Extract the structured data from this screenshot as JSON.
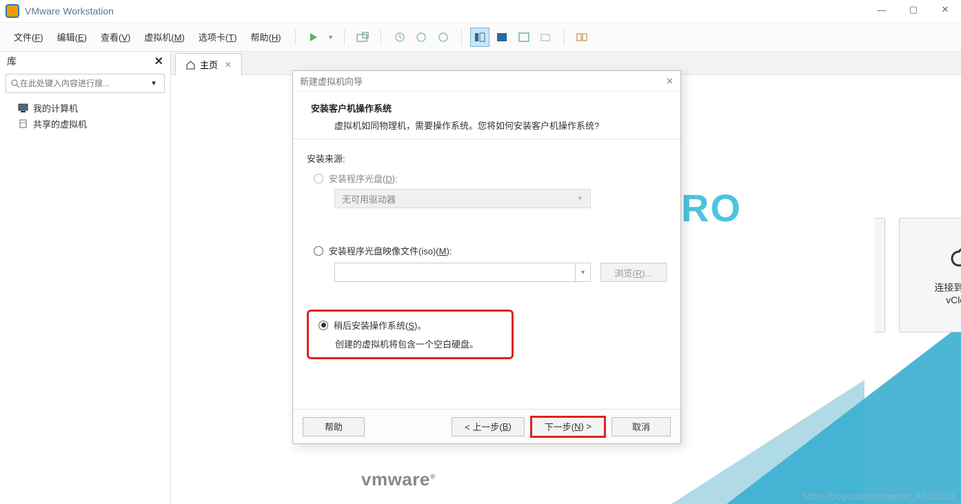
{
  "titlebar": {
    "app_name": "VMware Workstation"
  },
  "window_controls": {
    "min": "—",
    "max": "▢",
    "close": "✕"
  },
  "menu": {
    "file": "文件(F)",
    "edit": "编辑(E)",
    "view": "查看(V)",
    "vm": "虚拟机(M)",
    "tabs": "选项卡(T)",
    "help": "帮助(H)"
  },
  "sidebar": {
    "title": "库",
    "search_placeholder": "在此处键入内容进行搜...",
    "items": [
      {
        "label": "我的计算机"
      },
      {
        "label": "共享的虚拟机"
      }
    ]
  },
  "tab": {
    "home_label": "主页"
  },
  "bg": {
    "pro_text": "RO"
  },
  "cloud_card": {
    "line1": "连接到 VMware",
    "line2": "vCloud Air"
  },
  "vmware_logo": "vmware",
  "dialog": {
    "title": "新建虚拟机向导",
    "heading": "安装客户机操作系统",
    "subheading": "虚拟机如同物理机，需要操作系统。您将如何安装客户机操作系统?",
    "source_label": "安装来源:",
    "opt_disc": "安装程序光盘(D):",
    "disc_dropdown": "无可用驱动器",
    "opt_iso": "安装程序光盘映像文件(iso)(M):",
    "browse": "浏览(R)...",
    "opt_later": "稍后安装操作系统(S)。",
    "later_sub": "创建的虚拟机将包含一个空白硬盘。",
    "btn_help": "帮助",
    "btn_back": "< 上一步(B)",
    "btn_next": "下一步(N) >",
    "btn_cancel": "取消"
  },
  "underlines": {
    "file": "F",
    "edit": "E",
    "view": "V",
    "vm": "M",
    "tabs": "T",
    "help": "H",
    "disc": "D",
    "iso": "M",
    "browse": "R",
    "later": "S",
    "back": "B",
    "next": "N"
  },
  "watermark": "https://blog.csdn.net/weixin_44321110"
}
